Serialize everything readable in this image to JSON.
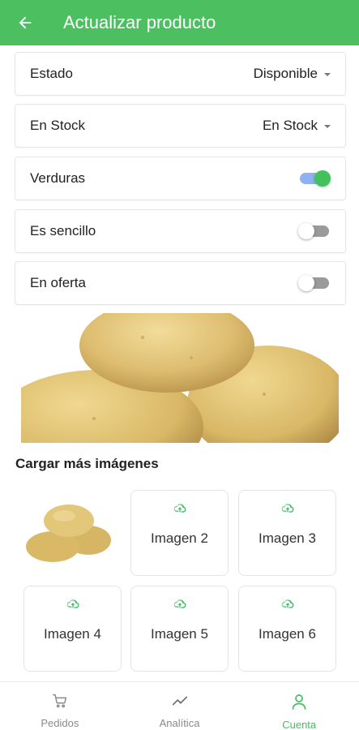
{
  "header": {
    "title": "Actualizar producto",
    "back_icon": "arrow-left-icon"
  },
  "form": {
    "estado": {
      "label": "Estado",
      "value": "Disponible"
    },
    "stock": {
      "label": "En Stock",
      "value": "En Stock"
    },
    "verduras": {
      "label": "Verduras",
      "on": true
    },
    "sencillo": {
      "label": "Es sencillo",
      "on": false
    },
    "oferta": {
      "label": "En oferta",
      "on": false
    }
  },
  "images": {
    "section_title": "Cargar más imágenes",
    "slots": [
      "Imagen 2",
      "Imagen 3",
      "Imagen 4",
      "Imagen 5",
      "Imagen 6"
    ],
    "upload_icon": "cloud-upload-icon"
  },
  "bottom_nav": {
    "items": [
      {
        "label": "Pedidos",
        "icon": "cart-icon",
        "active": false
      },
      {
        "label": "Analítica",
        "icon": "trend-icon",
        "active": false
      },
      {
        "label": "Cuenta",
        "icon": "user-icon",
        "active": true
      }
    ]
  },
  "colors": {
    "primary": "#4cc061",
    "toggle_on_thumb": "#43c15a",
    "toggle_on_track": "#8fb1f0",
    "nav_active": "#3fbf5f"
  }
}
